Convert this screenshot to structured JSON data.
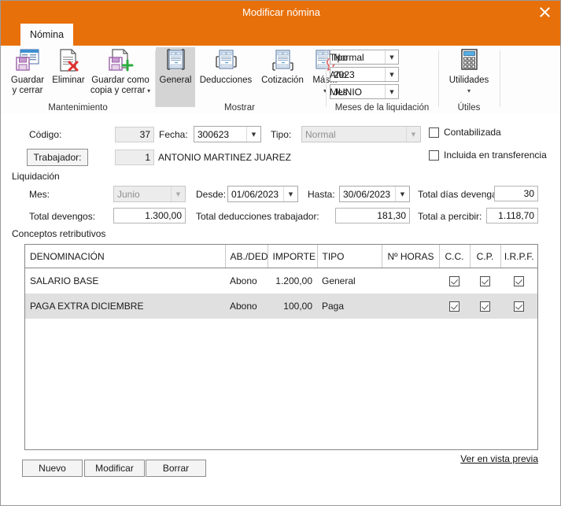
{
  "window": {
    "title": "Modificar nómina",
    "close_icon": "close-icon"
  },
  "tabs": [
    {
      "label": "Nómina",
      "selected": true
    }
  ],
  "ribbon": {
    "groups": [
      {
        "name": "Mantenimiento",
        "label": "Mantenimiento",
        "buttons": [
          {
            "label": "Guardar\ny cerrar",
            "line1": "Guardar",
            "line2": "y cerrar",
            "icon": "save-and-close-icon",
            "caret": false
          },
          {
            "label": "Eliminar",
            "line1": "Eliminar",
            "line2": "",
            "icon": "delete-document-icon",
            "caret": false
          },
          {
            "label": "Guardar como copia y cerrar",
            "line1": "Guardar como",
            "line2": "copia y cerrar",
            "icon": "save-as-copy-icon",
            "caret": true
          }
        ]
      },
      {
        "name": "Mostrar",
        "label": "Mostrar",
        "buttons": [
          {
            "line1": "General",
            "line2": "",
            "icon": "document-general-icon",
            "selected": true,
            "caret": false
          },
          {
            "line1": "Deducciones",
            "line2": "",
            "icon": "document-deductions-icon",
            "selected": false,
            "caret": false
          },
          {
            "line1": "Cotización",
            "line2": "",
            "icon": "document-contribution-icon",
            "selected": false,
            "caret": false
          },
          {
            "line1": "Más...",
            "line2": "",
            "icon": "document-more-icon",
            "selected": false,
            "caret": true
          }
        ]
      },
      {
        "name": "Meses de la liquidación",
        "label": "Meses de la liquidación",
        "combos": [
          {
            "label": "Tipo",
            "value": "Normal"
          },
          {
            "label": "Año",
            "value": "2023"
          },
          {
            "label": "Mes",
            "value": "JUNIO"
          }
        ]
      },
      {
        "name": "Útiles",
        "label": "Útiles",
        "buttons": [
          {
            "line1": "Utilidades",
            "line2": "",
            "icon": "calculator-icon",
            "caret": true
          }
        ]
      }
    ]
  },
  "form": {
    "codigo_label": "Código:",
    "codigo_value": "37",
    "fecha_label": "Fecha:",
    "fecha_value": "300623",
    "tipo_label": "Tipo:",
    "tipo_value": "Normal",
    "contabilizada_label": "Contabilizada",
    "contabilizada_checked": false,
    "trabajador_button": "Trabajador:",
    "trabajador_code": "1",
    "trabajador_name": "ANTONIO MARTINEZ JUAREZ",
    "incluida_label": "Incluida en transferencia",
    "incluida_checked": false,
    "liquidacion_label": "Liquidación",
    "mes_label": "Mes:",
    "mes_value": "Junio",
    "desde_label": "Desde:",
    "desde_value": "01/06/2023",
    "hasta_label": "Hasta:",
    "hasta_value": "30/06/2023",
    "total_dias_label": "Total días devengados:",
    "total_dias_value": "30",
    "total_devengos_label": "Total devengos:",
    "total_devengos_value": "1.300,00",
    "total_deducciones_label": "Total deducciones trabajador:",
    "total_deducciones_value": "181,30",
    "total_percibir_label": "Total a percibir:",
    "total_percibir_value": "1.118,70",
    "conceptos_label": "Conceptos retributivos"
  },
  "grid": {
    "columns": [
      {
        "label": "DENOMINACIÓN",
        "align": "left"
      },
      {
        "label": "AB./DED.",
        "align": "left"
      },
      {
        "label": "IMPORTE",
        "align": "right"
      },
      {
        "label": "TIPO",
        "align": "left"
      },
      {
        "label": "Nº HORAS",
        "align": "right"
      },
      {
        "label": "C.C.",
        "align": "center"
      },
      {
        "label": "C.P.",
        "align": "center"
      },
      {
        "label": "I.R.P.F.",
        "align": "center"
      }
    ],
    "rows": [
      {
        "denominacion": "SALARIO BASE",
        "abded": "Abono",
        "importe": "1.200,00",
        "tipo": "General",
        "horas": "",
        "cc": true,
        "cp": true,
        "irpf": true
      },
      {
        "denominacion": "PAGA EXTRA DICIEMBRE",
        "abded": "Abono",
        "importe": "100,00",
        "tipo": "Paga",
        "horas": "",
        "cc": true,
        "cp": true,
        "irpf": true
      }
    ]
  },
  "footer": {
    "nuevo": "Nuevo",
    "modificar": "Modificar",
    "borrar": "Borrar",
    "vista_previa": "Ver en vista previa"
  },
  "colors": {
    "accent": "#e8700a",
    "selected_row": "#e0e0e0",
    "ribbon_selected": "#d4d4d4"
  }
}
